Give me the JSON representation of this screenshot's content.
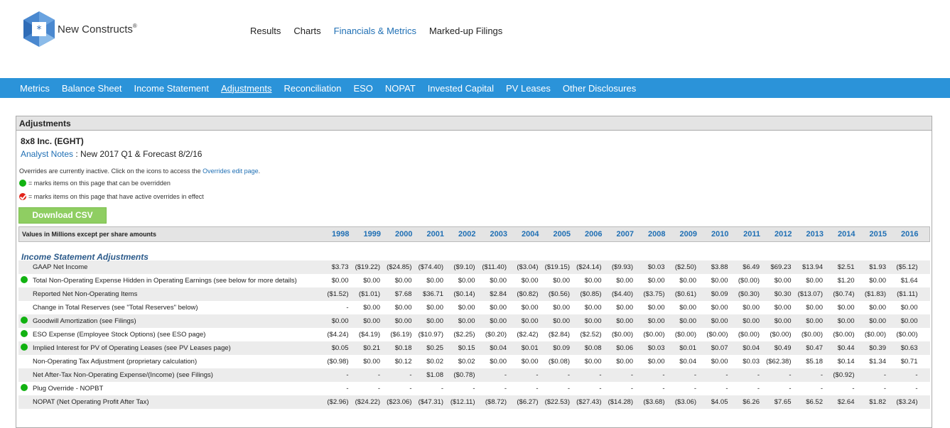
{
  "brand": {
    "name": "New Constructs",
    "mark": "®"
  },
  "topnav": [
    "Results",
    "Charts",
    "Financials & Metrics",
    "Marked-up Filings"
  ],
  "subnav": [
    "Metrics",
    "Balance Sheet",
    "Income Statement",
    "Adjustments",
    "Reconciliation",
    "ESO",
    "NOPAT",
    "Invested Capital",
    "PV Leases",
    "Other Disclosures"
  ],
  "panel": {
    "title": "Adjustments",
    "company": "8x8 Inc. (EGHT)",
    "notes_link": "Analyst Notes",
    "notes_text": " : New 2017 Q1 & Forecast 8/2/16",
    "overrides_text": "Overrides are currently inactive. Click on the icons to access the ",
    "overrides_link": "Overrides edit page",
    "overrides_end": ".",
    "legend_green": "= marks items on this page that can be overridden",
    "legend_red": "= marks items on this page that have active overrides in effect",
    "csv_button": "Download CSV"
  },
  "colors": {
    "accent_blue": "#2b93d9",
    "link_blue": "#1f6fb4",
    "green": "#11b211",
    "csv_green": "#8fce62"
  },
  "table": {
    "header_label": "Values in Millions except per share amounts",
    "years": [
      "1998",
      "1999",
      "2000",
      "2001",
      "2002",
      "2003",
      "2004",
      "2005",
      "2006",
      "2007",
      "2008",
      "2009",
      "2010",
      "2011",
      "2012",
      "2013",
      "2014",
      "2015",
      "2016"
    ],
    "section": "Income Statement Adjustments",
    "rows": [
      {
        "label": "GAAP Net Income",
        "marker": "",
        "values": [
          "$3.73",
          "($19.22)",
          "($24.85)",
          "($74.40)",
          "($9.10)",
          "($11.40)",
          "($3.04)",
          "($19.15)",
          "($24.14)",
          "($9.93)",
          "$0.03",
          "($2.50)",
          "$3.88",
          "$6.49",
          "$69.23",
          "$13.94",
          "$2.51",
          "$1.93",
          "($5.12)"
        ]
      },
      {
        "label": "Total Non-Operating Expense Hidden in Operating Earnings (see below for more details)",
        "marker": "green",
        "values": [
          "$0.00",
          "$0.00",
          "$0.00",
          "$0.00",
          "$0.00",
          "$0.00",
          "$0.00",
          "$0.00",
          "$0.00",
          "$0.00",
          "$0.00",
          "$0.00",
          "$0.00",
          "($0.00)",
          "$0.00",
          "$0.00",
          "$1.20",
          "$0.00",
          "$1.64"
        ]
      },
      {
        "label": "Reported Net Non-Operating Items",
        "marker": "",
        "values": [
          "($1.52)",
          "($1.01)",
          "$7.68",
          "$36.71",
          "($0.14)",
          "$2.84",
          "($0.82)",
          "($0.56)",
          "($0.85)",
          "($4.40)",
          "($3.75)",
          "($0.61)",
          "$0.09",
          "($0.30)",
          "$0.30",
          "($13.07)",
          "($0.74)",
          "($1.83)",
          "($1.11)"
        ]
      },
      {
        "label": "Change in Total Reserves (see \"Total Reserves\" below)",
        "marker": "",
        "values": [
          "-",
          "$0.00",
          "$0.00",
          "$0.00",
          "$0.00",
          "$0.00",
          "$0.00",
          "$0.00",
          "$0.00",
          "$0.00",
          "$0.00",
          "$0.00",
          "$0.00",
          "$0.00",
          "$0.00",
          "$0.00",
          "$0.00",
          "$0.00",
          "$0.00"
        ]
      },
      {
        "label": "Goodwill Amortization (see Filings)",
        "marker": "green",
        "values": [
          "$0.00",
          "$0.00",
          "$0.00",
          "$0.00",
          "$0.00",
          "$0.00",
          "$0.00",
          "$0.00",
          "$0.00",
          "$0.00",
          "$0.00",
          "$0.00",
          "$0.00",
          "$0.00",
          "$0.00",
          "$0.00",
          "$0.00",
          "$0.00",
          "$0.00"
        ]
      },
      {
        "label": "ESO Expense (Employee Stock Options) (see ESO page)",
        "marker": "green",
        "values": [
          "($4.24)",
          "($4.19)",
          "($6.19)",
          "($10.97)",
          "($2.25)",
          "($0.20)",
          "($2.42)",
          "($2.84)",
          "($2.52)",
          "($0.00)",
          "($0.00)",
          "($0.00)",
          "($0.00)",
          "($0.00)",
          "($0.00)",
          "($0.00)",
          "($0.00)",
          "($0.00)",
          "($0.00)"
        ]
      },
      {
        "label": "Implied Interest for PV of Operating Leases (see PV Leases page)",
        "marker": "green",
        "values": [
          "$0.05",
          "$0.21",
          "$0.18",
          "$0.25",
          "$0.15",
          "$0.04",
          "$0.01",
          "$0.09",
          "$0.08",
          "$0.06",
          "$0.03",
          "$0.01",
          "$0.07",
          "$0.04",
          "$0.49",
          "$0.47",
          "$0.44",
          "$0.39",
          "$0.63"
        ]
      },
      {
        "label": "Non-Operating Tax Adjustment (proprietary calculation)",
        "marker": "",
        "values": [
          "($0.98)",
          "$0.00",
          "$0.12",
          "$0.02",
          "$0.02",
          "$0.00",
          "$0.00",
          "($0.08)",
          "$0.00",
          "$0.00",
          "$0.00",
          "$0.04",
          "$0.00",
          "$0.03",
          "($62.38)",
          "$5.18",
          "$0.14",
          "$1.34",
          "$0.71"
        ]
      },
      {
        "label": "Net After-Tax Non-Operating Expense/(Income) (see Filings)",
        "marker": "",
        "values": [
          "-",
          "-",
          "-",
          "$1.08",
          "($0.78)",
          "-",
          "-",
          "-",
          "-",
          "-",
          "-",
          "-",
          "-",
          "-",
          "-",
          "-",
          "($0.92)",
          "-",
          "-"
        ]
      },
      {
        "label": "Plug Override - NOPBT",
        "marker": "green",
        "values": [
          "-",
          "-",
          "-",
          "-",
          "-",
          "-",
          "-",
          "-",
          "-",
          "-",
          "-",
          "-",
          "-",
          "-",
          "-",
          "-",
          "-",
          "-",
          "-"
        ]
      },
      {
        "label": "NOPAT (Net Operating Profit After Tax)",
        "marker": "",
        "values": [
          "($2.96)",
          "($24.22)",
          "($23.06)",
          "($47.31)",
          "($12.11)",
          "($8.72)",
          "($6.27)",
          "($22.53)",
          "($27.43)",
          "($14.28)",
          "($3.68)",
          "($3.06)",
          "$4.05",
          "$6.26",
          "$7.65",
          "$6.52",
          "$2.64",
          "$1.82",
          "($3.24)"
        ]
      }
    ]
  }
}
